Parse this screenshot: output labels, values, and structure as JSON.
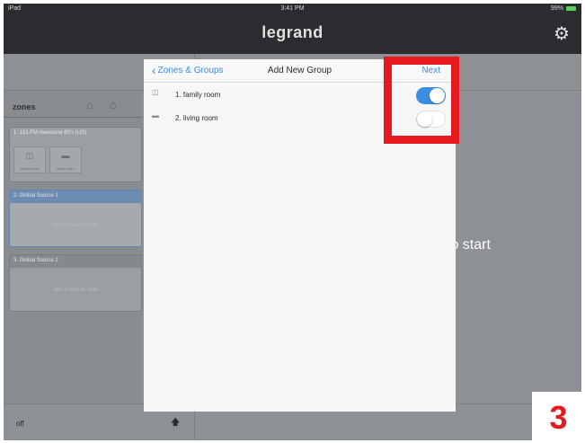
{
  "status_bar": {
    "carrier": "iPad",
    "time": "3:41 PM",
    "battery": "99%"
  },
  "header": {
    "brand": "legrand"
  },
  "sidebar": {
    "title": "zones",
    "sources": [
      {
        "title": "1. 181.FM Awesome 80's (US)",
        "zones": [
          {
            "label": "family room"
          },
          {
            "label": "living room"
          }
        ]
      },
      {
        "title": "2. Global Source 1",
        "hint": "add a zone to start"
      },
      {
        "title": "3. Global Source 2",
        "hint": "add a zone to start"
      }
    ]
  },
  "bottom_bar": {
    "status": "off"
  },
  "detail": {
    "text": "to start"
  },
  "modal": {
    "back_label": "Zones & Groups",
    "title": "Add New Group",
    "next_label": "Next",
    "zones": [
      {
        "label": "1. family room",
        "icon": "tv-icon",
        "selected": true
      },
      {
        "label": "2. living room",
        "icon": "sofa-icon",
        "selected": false
      }
    ]
  },
  "annotation": {
    "step": "3"
  },
  "colors": {
    "accent": "#3b8de2",
    "highlight": "#e6191e",
    "header": "#2b2c2f"
  }
}
